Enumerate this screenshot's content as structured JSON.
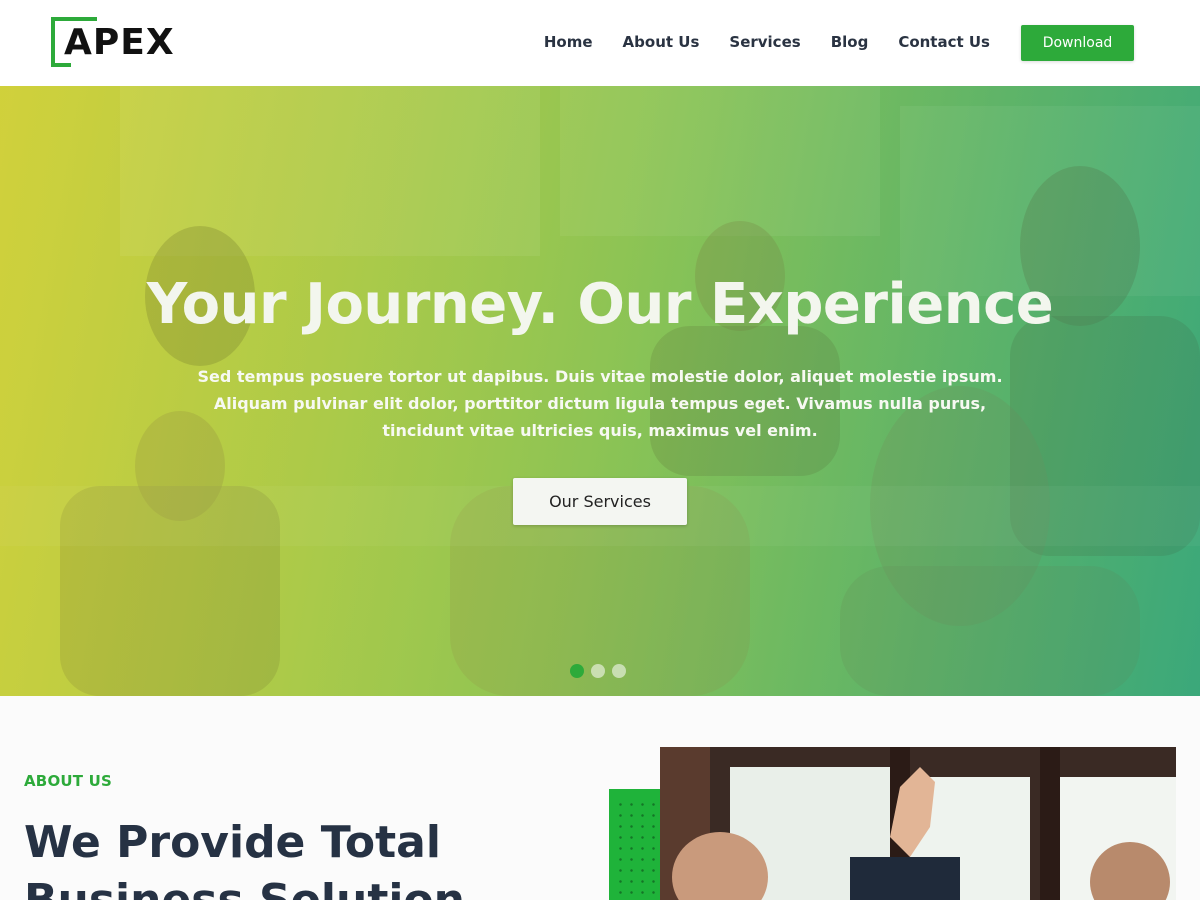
{
  "header": {
    "logo_text": "APEX",
    "nav": [
      "Home",
      "About Us",
      "Services",
      "Blog",
      "Contact Us"
    ],
    "download_label": "Download"
  },
  "hero": {
    "title": "Your Journey. Our Experience",
    "subtitle": "Sed tempus posuere tortor ut dapibus. Duis vitae molestie dolor, aliquet molestie ipsum. Aliquam pulvinar elit dolor, porttitor dictum ligula tempus eget. Vivamus nulla purus, tincidunt vitae ultricies quis, maximus vel enim.",
    "button_label": "Our Services",
    "slides_total": 3,
    "active_slide": 1
  },
  "about": {
    "label": "ABOUT US",
    "title": "We Provide Total Business Solution"
  },
  "colors": {
    "brand_green": "#2daa3a",
    "heading_dark": "#263244"
  }
}
